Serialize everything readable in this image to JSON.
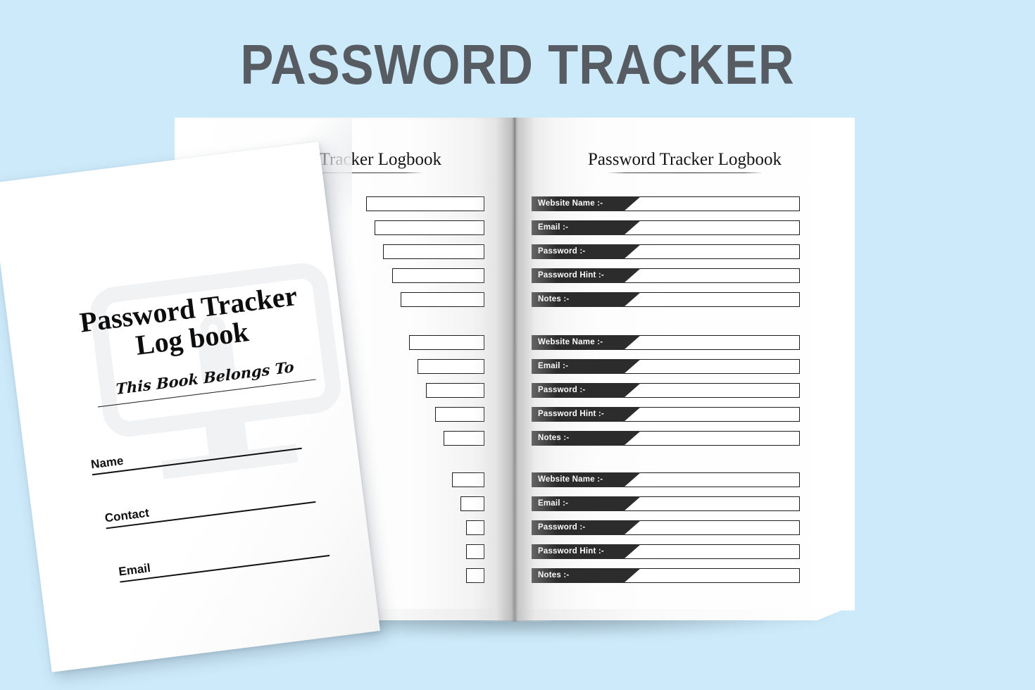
{
  "background_color": "#cdeafa",
  "header": {
    "title": "PASSWORD TRACKER",
    "title_color": "#565c61"
  },
  "cover": {
    "title_line1": "Password Tracker",
    "title_line2": "Log book",
    "belongs_to": "This Book Belongs To",
    "fields": [
      {
        "label": "Name"
      },
      {
        "label": "Contact"
      },
      {
        "label": "Email"
      }
    ],
    "watermark_icon": "monitor-lock-icon"
  },
  "interior": {
    "left_page": {
      "heading": "Password Tracker Logbook",
      "heading_visible_fragment": "er Logbook",
      "group_count": 3,
      "rows_per_group": 5
    },
    "right_page": {
      "heading": "Password Tracker Logbook",
      "groups": [
        {
          "rows": [
            {
              "label": "Website Name :-",
              "value": ""
            },
            {
              "label": "Email :-",
              "value": ""
            },
            {
              "label": "Password :-",
              "value": ""
            },
            {
              "label": "Password Hint :-",
              "value": ""
            },
            {
              "label": "Notes :-",
              "value": ""
            }
          ]
        },
        {
          "rows": [
            {
              "label": "Website Name :-",
              "value": ""
            },
            {
              "label": "Email :-",
              "value": ""
            },
            {
              "label": "Password :-",
              "value": ""
            },
            {
              "label": "Password Hint :-",
              "value": ""
            },
            {
              "label": "Notes :-",
              "value": ""
            }
          ]
        },
        {
          "rows": [
            {
              "label": "Website Name :-",
              "value": ""
            },
            {
              "label": "Email :-",
              "value": ""
            },
            {
              "label": "Password :-",
              "value": ""
            },
            {
              "label": "Password Hint :-",
              "value": ""
            },
            {
              "label": "Notes :-",
              "value": ""
            }
          ]
        }
      ]
    }
  },
  "colors": {
    "label_block": "#2c2c2c",
    "box_border": "#1e1e1e",
    "paper": "#ffffff",
    "watermark": "#f1f2f4"
  }
}
